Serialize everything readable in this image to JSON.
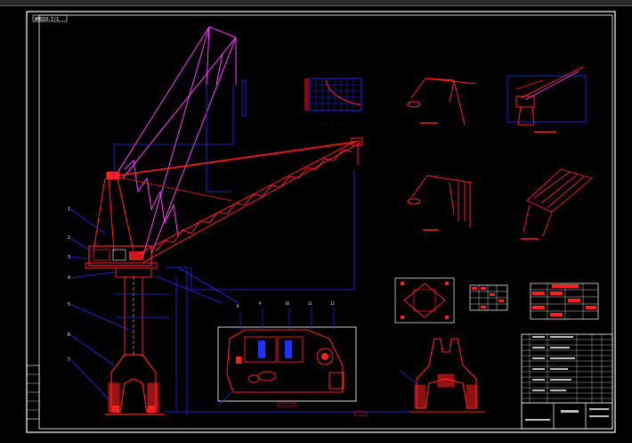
{
  "drawing": {
    "title_stamp": "WMQ10-T/1",
    "chart_caption": "· · ·  · · ·",
    "part_numbers": [
      "1",
      "2",
      "3",
      "4",
      "5",
      "6",
      "7",
      "8",
      "9",
      "10",
      "11",
      "12"
    ],
    "colors": {
      "background": "#000000",
      "frame": "#ffffff",
      "structure": "#ff2020",
      "jib_raised": "#ff40ff",
      "dimension": "#2030ff",
      "title_block": "#ffffff"
    }
  }
}
